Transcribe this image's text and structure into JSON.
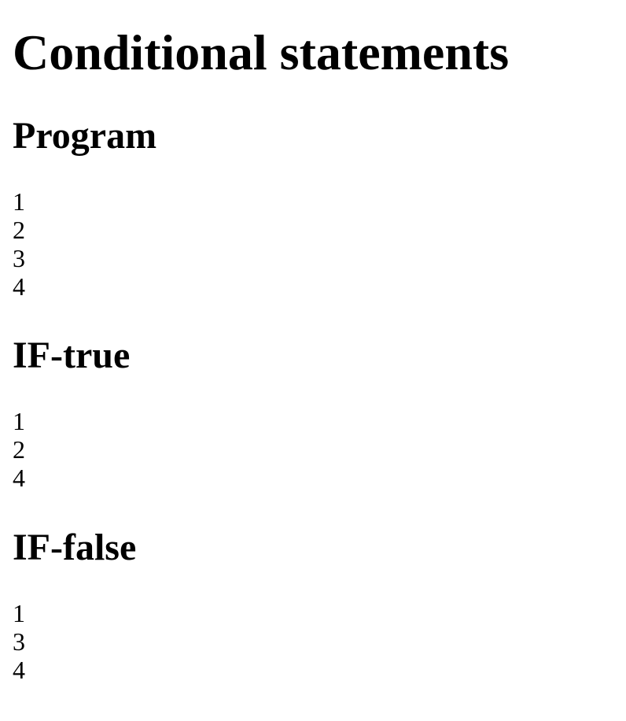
{
  "title": "Conditional statements",
  "sections": [
    {
      "heading": "Program",
      "lines": [
        "1",
        "2",
        "3",
        "4"
      ]
    },
    {
      "heading": "IF-true",
      "lines": [
        "1",
        "2",
        "4"
      ]
    },
    {
      "heading": "IF-false",
      "lines": [
        "1",
        "3",
        "4"
      ]
    }
  ]
}
